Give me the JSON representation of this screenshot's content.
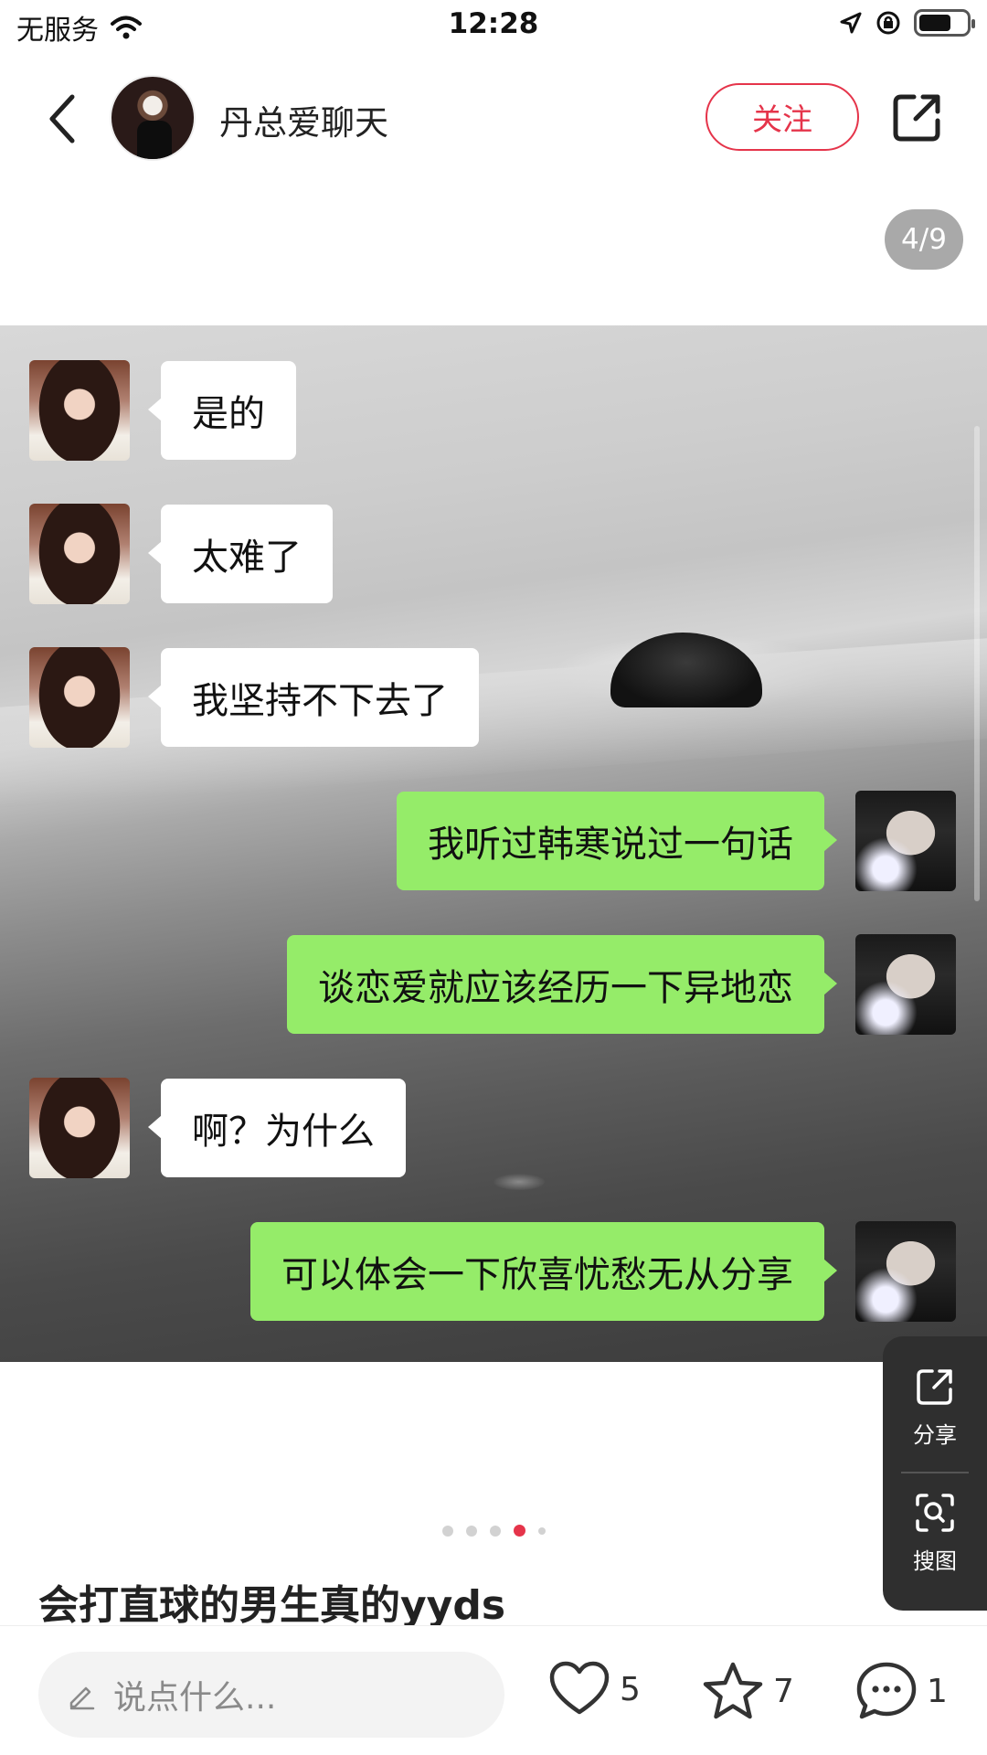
{
  "status_bar": {
    "carrier": "无服务",
    "time": "12:28"
  },
  "header": {
    "author_name": "丹总爱聊天",
    "follow_label": "关注"
  },
  "image_counter": "4/9",
  "chat": {
    "messages": [
      {
        "side": "left",
        "text": "是的"
      },
      {
        "side": "left",
        "text": "太难了"
      },
      {
        "side": "left",
        "text": "我坚持不下去了"
      },
      {
        "side": "right",
        "text": "我听过韩寒说过一句话"
      },
      {
        "side": "right",
        "text": "谈恋爱就应该经历一下异地恋"
      },
      {
        "side": "left",
        "text": "啊？为什么"
      },
      {
        "side": "right",
        "text": "可以体会一下欣喜忧愁无从分享"
      }
    ]
  },
  "side_panel": {
    "share_label": "分享",
    "search_image_label": "搜图"
  },
  "post": {
    "title": "会打直球的男生真的yyds"
  },
  "bottom_bar": {
    "comment_placeholder": "说点什么...",
    "like_count": "5",
    "collect_count": "7",
    "comment_count": "1"
  },
  "colors": {
    "accent": "#e5344a",
    "green_bubble": "#95ec69",
    "white_bubble": "#ffffff"
  },
  "icons": [
    "wifi-icon",
    "location-icon",
    "rotation-lock-icon",
    "battery-icon",
    "back-icon",
    "share-icon",
    "search-image-icon",
    "edit-icon",
    "heart-icon",
    "star-icon",
    "comment-icon"
  ]
}
